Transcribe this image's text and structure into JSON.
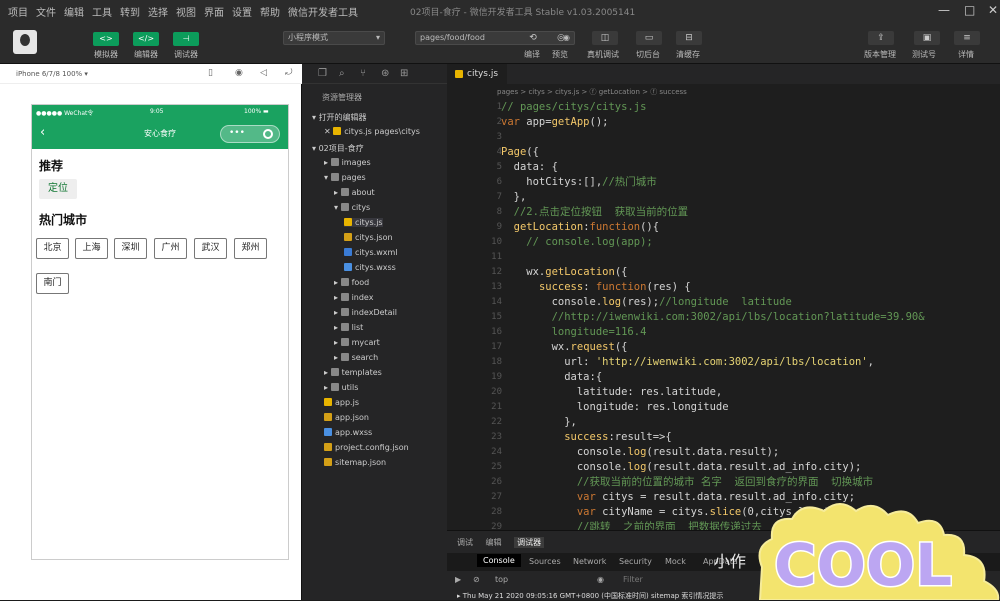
{
  "menubar": {
    "items": [
      "项目",
      "文件",
      "编辑",
      "工具",
      "转到",
      "选择",
      "视图",
      "界面",
      "设置",
      "帮助",
      "微信开发者工具"
    ],
    "window_title": "02项目-食疗 - 微信开发者工具 Stable v1.03.2005141"
  },
  "toolbar": {
    "green_buttons": [
      {
        "icon": "<>",
        "label": "模拟器"
      },
      {
        "icon": "</>",
        "label": "编辑器"
      },
      {
        "icon": "⊣",
        "label": "调试器"
      }
    ],
    "mode_select": "小程序模式",
    "compile_select": "pages/food/food",
    "right_group": [
      {
        "icon": "⟲",
        "label": "编译"
      },
      {
        "icon": "◎",
        "label": "预览"
      },
      {
        "icon": "◫",
        "label": "真机调试"
      },
      {
        "icon": "▭",
        "label": "切后台"
      },
      {
        "icon": "⊟",
        "label": "清缓存"
      }
    ],
    "far_right": [
      {
        "icon": "⇪",
        "label": "版本管理"
      },
      {
        "icon": "▣",
        "label": "测试号"
      },
      {
        "icon": "≡",
        "label": "详情"
      }
    ]
  },
  "simulator": {
    "device": "iPhone 6/7/8 100% ▾",
    "carrier": "●●●●● WeChat令",
    "time": "9:05",
    "battery": "100% ▬",
    "page_title": "安心食疗",
    "back": "‹",
    "dots": "•••",
    "recommend": "推荐",
    "locate_btn": "定位",
    "hot": "热门城市",
    "cities": [
      "北京",
      "上海",
      "深圳",
      "广州",
      "武汉",
      "郑州",
      "南门"
    ]
  },
  "explorer": {
    "header": "资源管理器",
    "open_editors": "打开的编辑器",
    "open_file": "citys.js pages\\citys",
    "project": "02项目-食疗",
    "items": [
      {
        "name": "images",
        "depth": 1,
        "kind": "folder",
        "open": false
      },
      {
        "name": "pages",
        "depth": 1,
        "kind": "folder",
        "open": true
      },
      {
        "name": "about",
        "depth": 2,
        "kind": "folder",
        "open": false
      },
      {
        "name": "citys",
        "depth": 2,
        "kind": "folder",
        "open": true
      },
      {
        "name": "citys.js",
        "depth": 3,
        "kind": "js",
        "open": false
      },
      {
        "name": "citys.json",
        "depth": 3,
        "kind": "json",
        "open": false
      },
      {
        "name": "citys.wxml",
        "depth": 3,
        "kind": "wxml",
        "open": false
      },
      {
        "name": "citys.wxss",
        "depth": 3,
        "kind": "wxss",
        "open": false
      },
      {
        "name": "food",
        "depth": 2,
        "kind": "folder",
        "open": false
      },
      {
        "name": "index",
        "depth": 2,
        "kind": "folder",
        "open": false
      },
      {
        "name": "indexDetail",
        "depth": 2,
        "kind": "folder",
        "open": false
      },
      {
        "name": "list",
        "depth": 2,
        "kind": "folder",
        "open": false
      },
      {
        "name": "mycart",
        "depth": 2,
        "kind": "folder",
        "open": false
      },
      {
        "name": "search",
        "depth": 2,
        "kind": "folder",
        "open": false
      },
      {
        "name": "templates",
        "depth": 1,
        "kind": "folder",
        "open": false
      },
      {
        "name": "utils",
        "depth": 1,
        "kind": "folder",
        "open": false
      },
      {
        "name": "app.js",
        "depth": 1,
        "kind": "js",
        "open": false
      },
      {
        "name": "app.json",
        "depth": 1,
        "kind": "json",
        "open": false
      },
      {
        "name": "app.wxss",
        "depth": 1,
        "kind": "wxss",
        "open": false
      },
      {
        "name": "project.config.json",
        "depth": 1,
        "kind": "json",
        "open": false
      },
      {
        "name": "sitemap.json",
        "depth": 1,
        "kind": "json",
        "open": false
      }
    ]
  },
  "editor": {
    "tab": "citys.js",
    "breadcrumb": "pages > citys > citys.js > ⓕ getLocation > ⓕ success",
    "line_numbers": [
      "1",
      "2",
      "3",
      "4",
      "5",
      "6",
      "7",
      "8",
      "9",
      "10",
      "11",
      "12",
      "13",
      "14",
      "15",
      "16",
      "17",
      "18",
      "19",
      "20",
      "21",
      "22",
      "23",
      "24",
      "25",
      "26",
      "27",
      "28",
      "29",
      "30",
      "31",
      "32"
    ]
  },
  "console": {
    "tabs": [
      "调试",
      "编辑",
      "调试器"
    ],
    "subtabs": [
      "Console",
      "Sources",
      "Network",
      "Security",
      "Mock",
      "AppData"
    ],
    "filter_context": "top",
    "filter_placeholder": "Filter",
    "log": "▸ Thu May 21 2020 09:05:16 GMT+0800 (中国标准时间) sitemap 索引情况提示"
  },
  "sticker_text": "COOL",
  "watermark": "小作",
  "colors": {
    "wechat_green": "#1aa260",
    "button_green": "#0c9c5b",
    "editor_bg": "#1e1e1e"
  }
}
